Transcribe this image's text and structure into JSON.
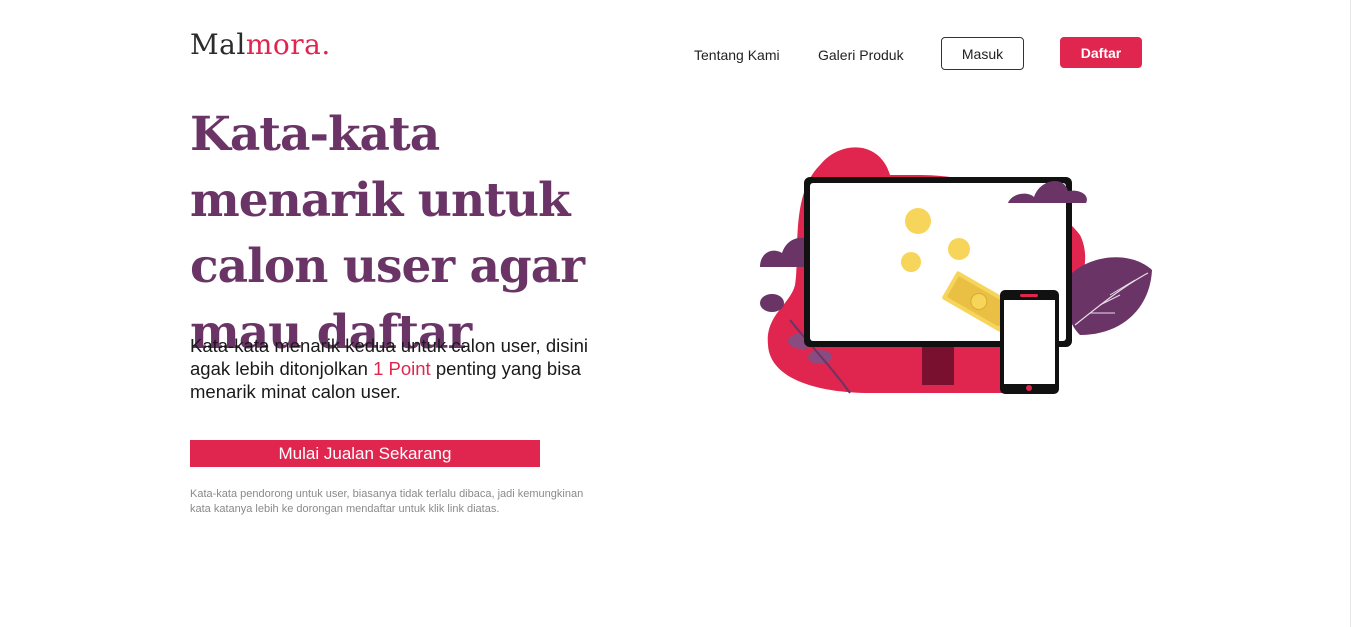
{
  "header": {
    "logo_part1": "Mal",
    "logo_part2": "mora.",
    "nav": {
      "about": "Tentang Kami",
      "gallery": "Galeri Produk",
      "login": "Masuk",
      "register": "Daftar"
    }
  },
  "hero": {
    "title": "Kata-kata menarik untuk calon user agar mau daftar",
    "subtitle_before": "Kata-kata menarik kedua untuk calon user, disini agak lebih ditonjolkan ",
    "subtitle_highlight": "1 Point",
    "subtitle_after": " penting yang bisa menarik minat calon user.",
    "cta_label": "Mulai Jualan Sekarang",
    "note": "Kata-kata pendorong untuk user, biasanya tidak terlalu dibaca, jadi kemungkinan kata katanya lebih ke dorongan mendaftar untuk klik link diatas."
  },
  "colors": {
    "brand": "#e0254f",
    "title": "#6a3466",
    "plum": "#6a3466",
    "coin": "#f7d45a"
  },
  "icons": {
    "illustration": "monitor-phone-money-illustration"
  }
}
